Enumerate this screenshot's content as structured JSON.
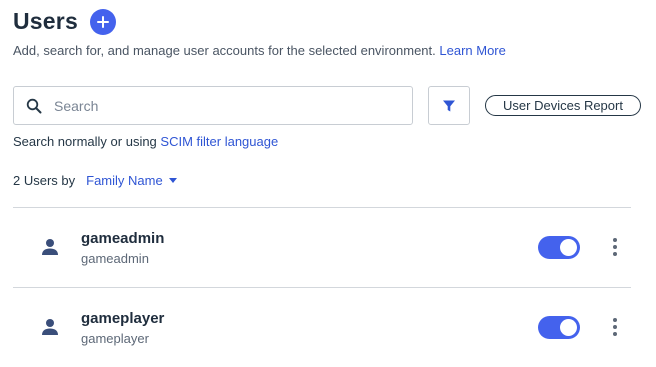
{
  "header": {
    "title": "Users",
    "add_icon": "plus-icon",
    "subtitle": "Add, search for, and manage user accounts for the selected environment.",
    "learn_more": "Learn More"
  },
  "search": {
    "placeholder": "Search",
    "value": "",
    "icon": "search-icon",
    "filter_icon": "filter-icon",
    "hint_text": "Search normally or using",
    "hint_link": "SCIM filter language"
  },
  "report_button": "User Devices Report",
  "sort": {
    "count_label": "2 Users by",
    "selected": "Family Name"
  },
  "colors": {
    "accent": "#4462ed",
    "link": "#2f55d4"
  },
  "users": [
    {
      "name": "gameadmin",
      "username": "gameadmin",
      "enabled": true
    },
    {
      "name": "gameplayer",
      "username": "gameplayer",
      "enabled": true
    }
  ]
}
